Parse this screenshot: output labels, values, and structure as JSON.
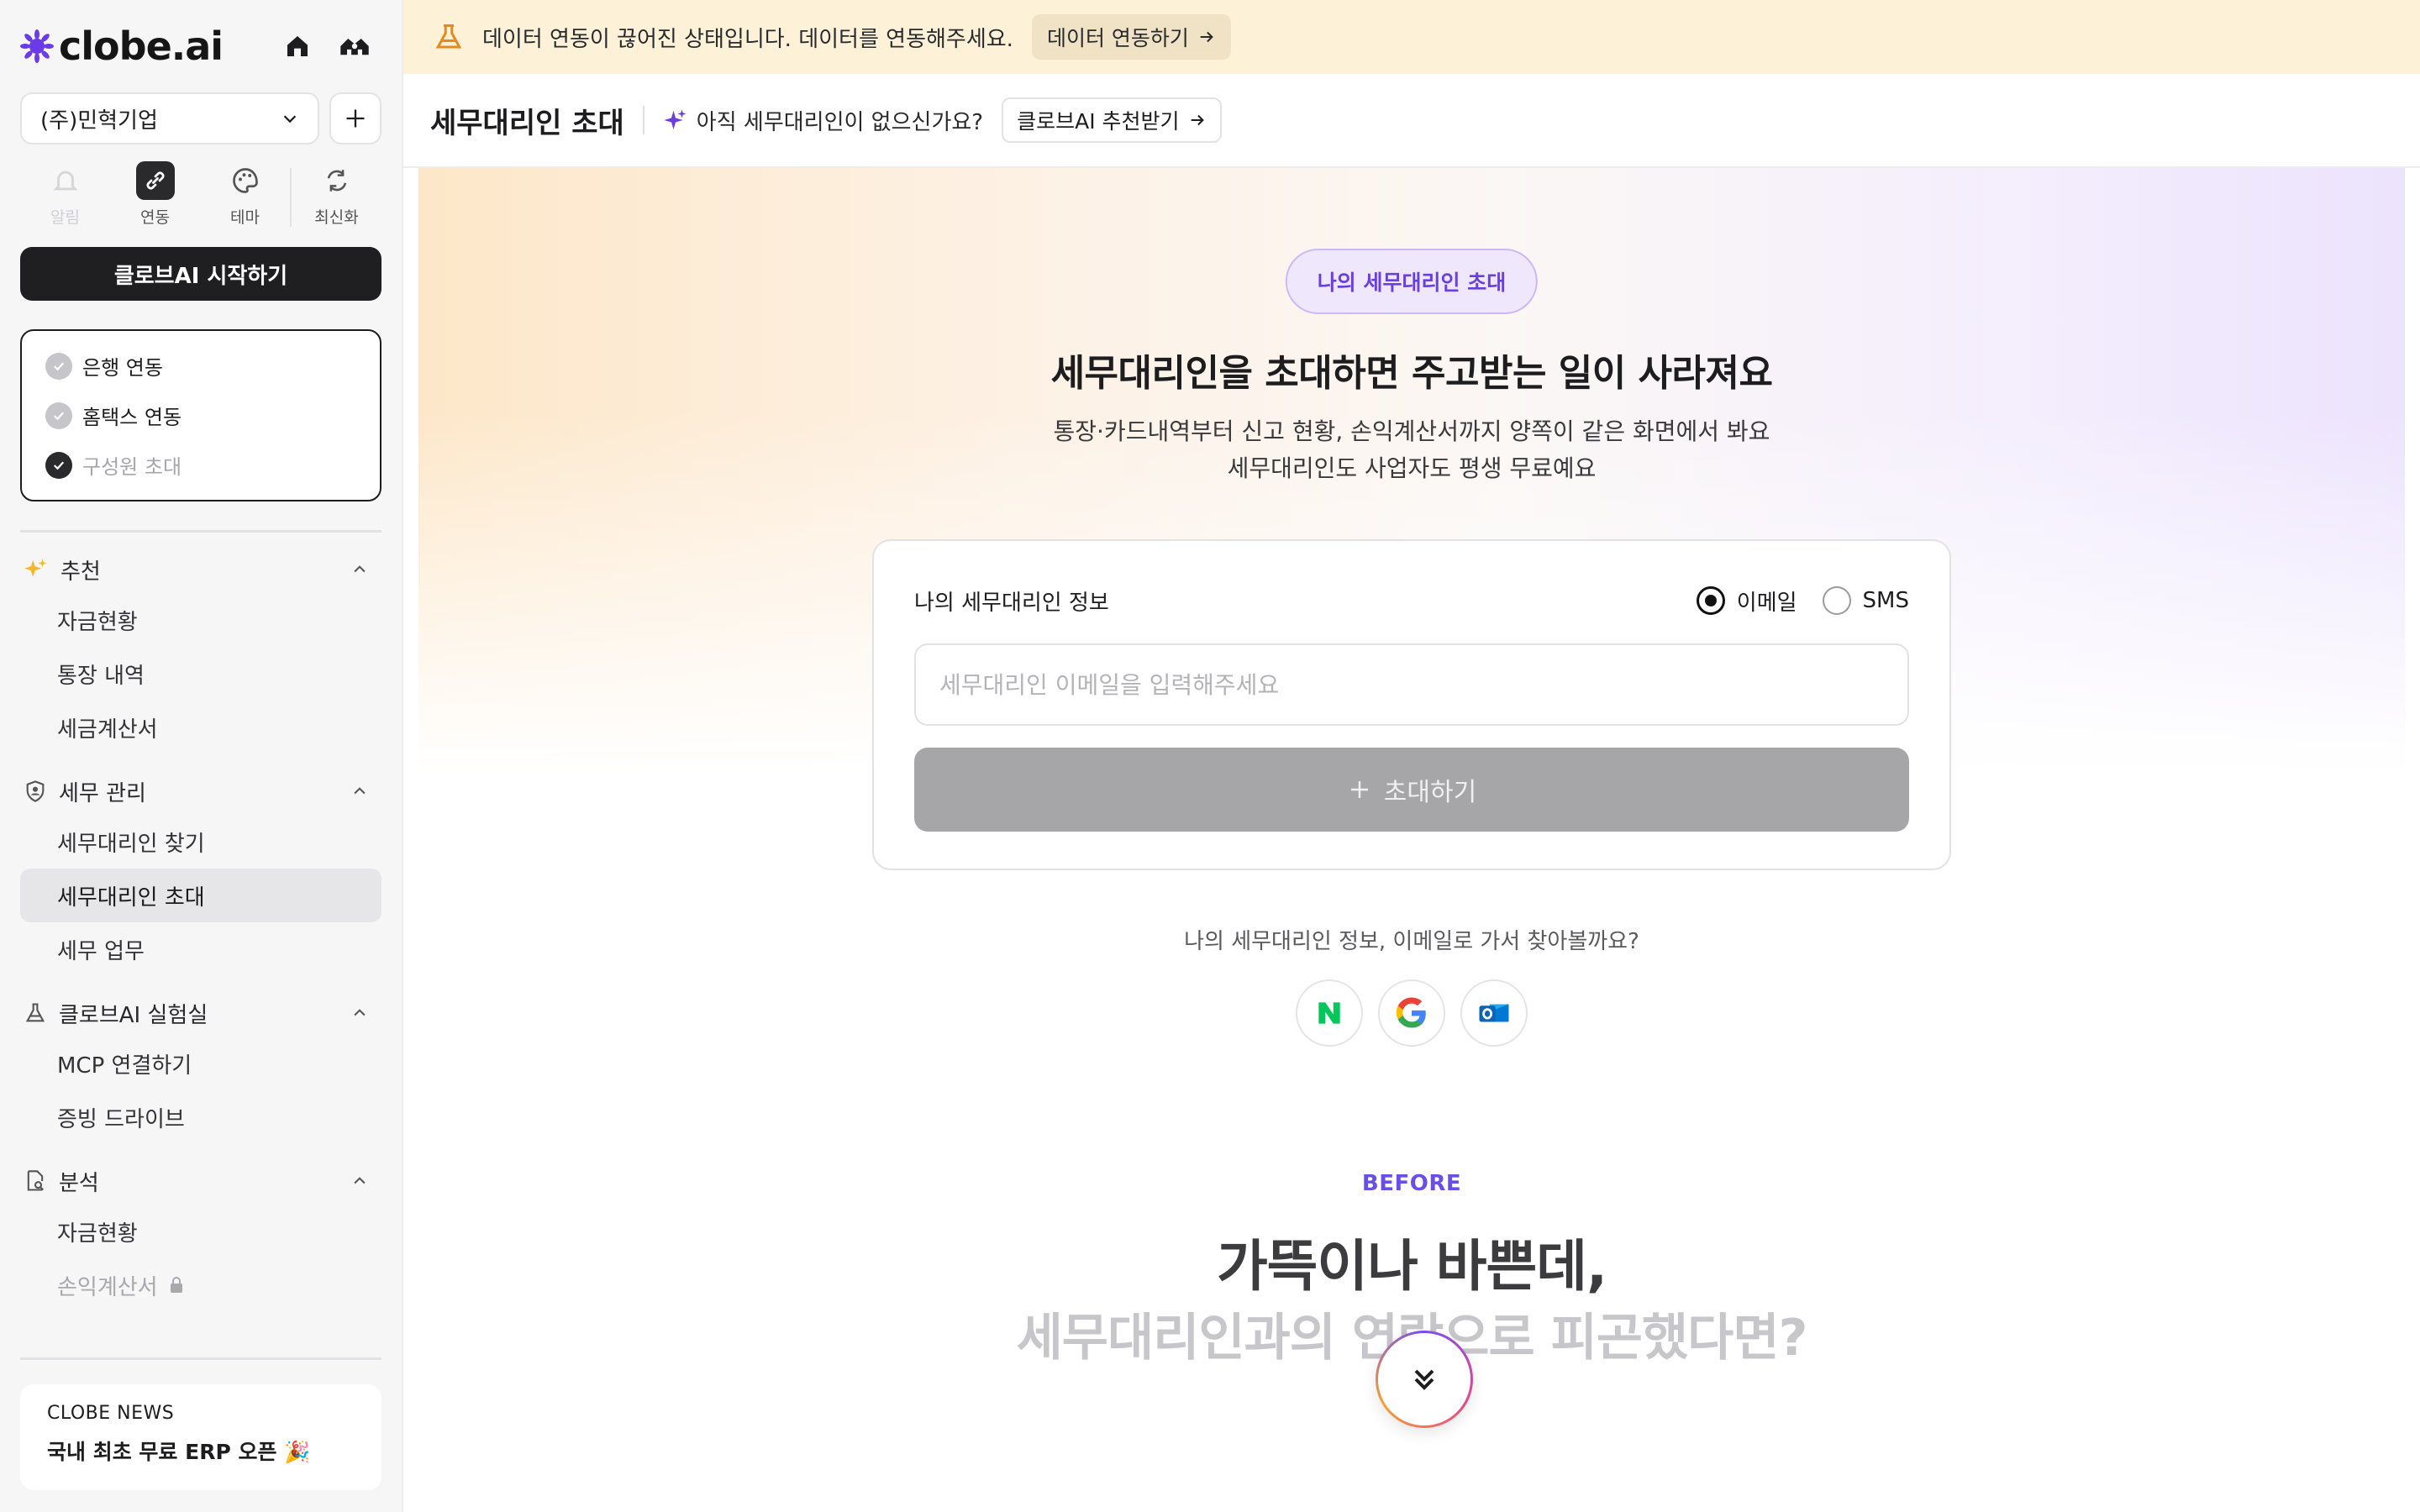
{
  "app": {
    "logo_text": "clobe.ai"
  },
  "sidebar": {
    "company": "(주)민혁기업",
    "quick": [
      {
        "label": "알림",
        "icon": "bell-icon"
      },
      {
        "label": "연동",
        "icon": "link-icon"
      },
      {
        "label": "테마",
        "icon": "palette-icon"
      },
      {
        "label": "최신화",
        "icon": "refresh-icon"
      }
    ],
    "start_label": "클로브AI 시작하기",
    "checklist": [
      {
        "label": "은행 연동"
      },
      {
        "label": "홈택스 연동"
      },
      {
        "label": "구성원 초대"
      }
    ],
    "sections": [
      {
        "title": "추천",
        "items": [
          "자금현황",
          "통장 내역",
          "세금계산서"
        ]
      },
      {
        "title": "세무 관리",
        "items": [
          "세무대리인 찾기",
          "세무대리인 초대",
          "세무 업무"
        ]
      },
      {
        "title": "클로브AI 실험실",
        "items": [
          "MCP 연결하기",
          "증빙 드라이브"
        ]
      },
      {
        "title": "분석",
        "items": [
          "자금현황",
          "손익계산서"
        ]
      }
    ],
    "news": {
      "label": "CLOBE NEWS",
      "title": "국내 최초 무료 ERP 오픈 🎉"
    }
  },
  "banner": {
    "text": "데이터 연동이 끊어진 상태입니다. 데이터를 연동해주세요.",
    "button": "데이터 연동하기"
  },
  "topbar": {
    "title": "세무대리인 초대",
    "hint": "아직 세무대리인이 없으신가요?",
    "button": "클로브AI 추천받기"
  },
  "hero": {
    "pill": "나의 세무대리인 초대",
    "title": "세무대리인을 초대하면 주고받는 일이 사라져요",
    "sub1": "통장·카드내역부터 신고 현황, 손익계산서까지 양쪽이 같은 화면에서 봐요",
    "sub2": "세무대리인도 사업자도 평생 무료예요"
  },
  "form": {
    "label": "나의 세무대리인 정보",
    "radio_email": "이메일",
    "radio_sms": "SMS",
    "selected": "이메일",
    "placeholder": "세무대리인 이메일을 입력해주세요",
    "submit": "초대하기"
  },
  "find": {
    "text": "나의 세무대리인 정보, 이메일로 가서 찾아볼까요?"
  },
  "mail_providers": [
    "naver-mail-icon",
    "gmail-icon",
    "outlook-icon"
  ],
  "before": {
    "tag": "BEFORE",
    "line1": "가뜩이나 바쁜데,",
    "line2": "세무대리인과의 연락으로 피곤했다면?"
  },
  "colors": {
    "accent": "#6a3fe0",
    "banner_bg": "#fdf1d8",
    "dark_button": "#1f1f21"
  }
}
